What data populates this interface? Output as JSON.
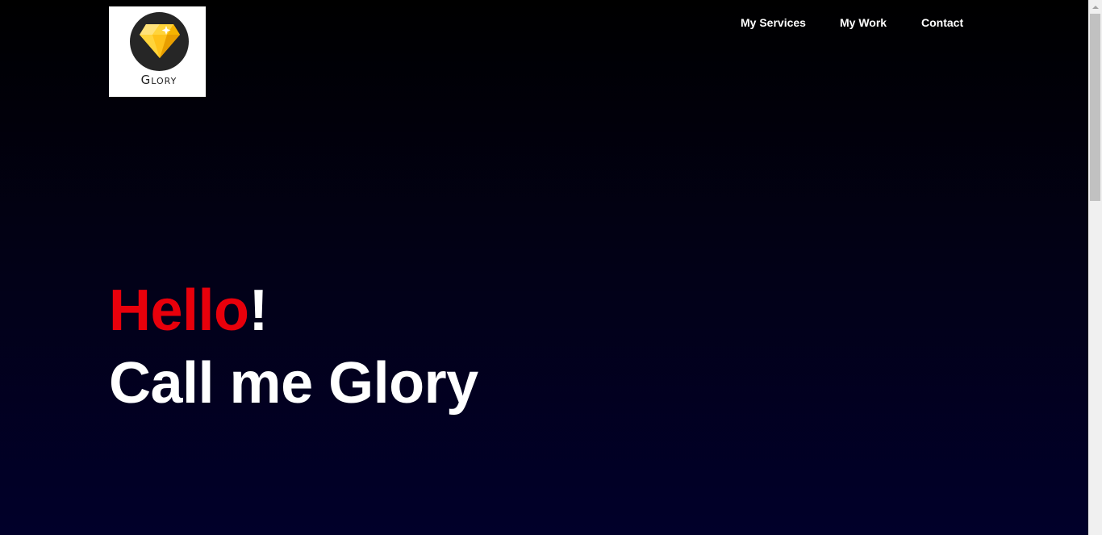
{
  "logo": {
    "text": "Glory",
    "icon": "diamond-icon",
    "colors": {
      "circle": "#262626",
      "diamond_light": "#ffd43b",
      "diamond_dark": "#f0a800"
    }
  },
  "nav": {
    "items": [
      {
        "label": "My Services"
      },
      {
        "label": "My Work"
      },
      {
        "label": "Contact"
      }
    ]
  },
  "hero": {
    "hello": "Hello",
    "exclamation": "!",
    "subtitle": "Call me Glory",
    "accent_color": "#e8000b"
  }
}
